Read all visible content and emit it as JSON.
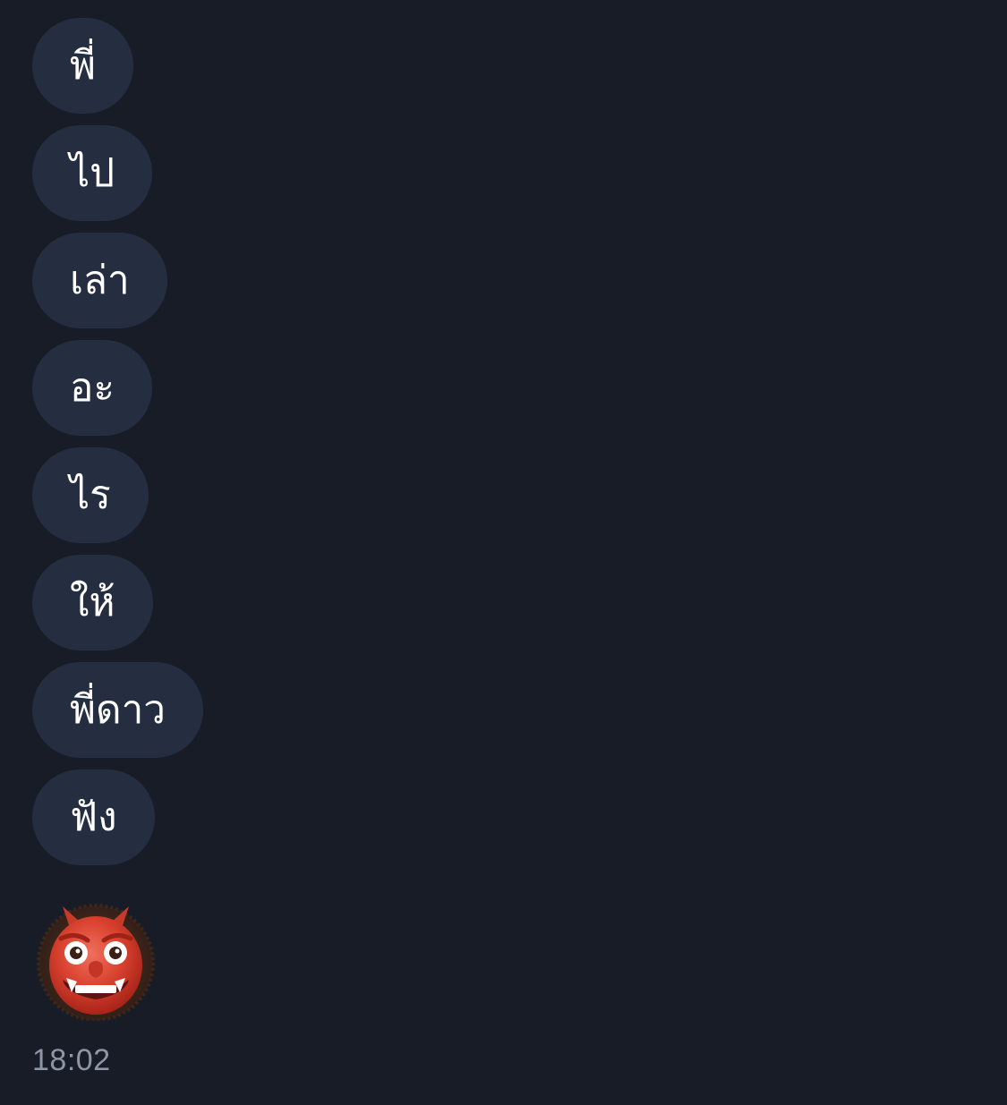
{
  "chat": {
    "messages": [
      {
        "text": "พี่"
      },
      {
        "text": "ไป"
      },
      {
        "text": "เล่า"
      },
      {
        "text": "อะ"
      },
      {
        "text": "ไร"
      },
      {
        "text": "ให้"
      },
      {
        "text": "พี่ดาว"
      },
      {
        "text": "ฟัง"
      }
    ],
    "sticker": {
      "icon": "ogre-icon"
    },
    "timestamp": "18:02"
  },
  "colors": {
    "background": "#171c27",
    "bubble": "#252e40",
    "text": "#ffffff",
    "timestamp": "#8e95a5"
  }
}
